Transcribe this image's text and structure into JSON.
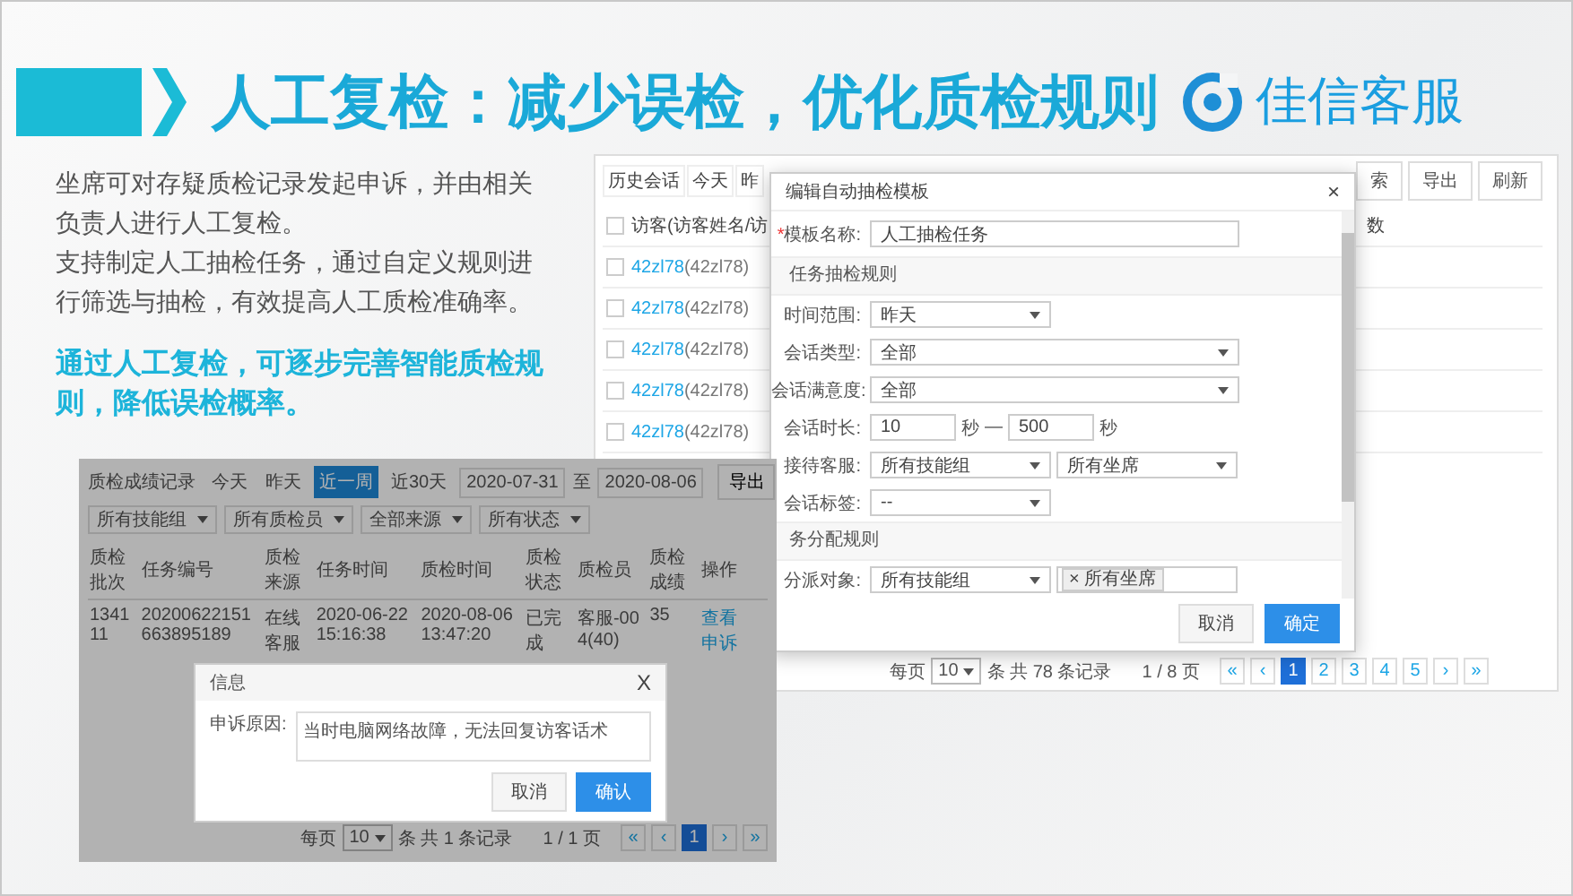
{
  "header": {
    "title": "人工复检：减少误检，优化质检规则",
    "brand": "佳信客服"
  },
  "intro": {
    "paragraphs": [
      "坐席可对存疑质检记录发起申诉，并由相关负责人进行人工复检。",
      "支持制定人工抽检任务，通过自定义规则进行筛选与抽检，有效提高人工质检准确率。"
    ],
    "highlight": "通过人工复检，可逐步完善智能质检规则，降低误检概率。"
  },
  "session_window": {
    "tabs": [
      {
        "label": "历史会话",
        "selected": false
      },
      {
        "label": "今天",
        "selected": false
      },
      {
        "label": "昨",
        "selected": false
      }
    ],
    "buttons": [
      "索",
      "导出",
      "刷新"
    ],
    "all_checked": false,
    "columns": [
      "访客(访客姓名/访",
      "数"
    ],
    "rows": [
      {
        "checked": false,
        "link": "42zl78",
        "name": "(42zl78)"
      },
      {
        "checked": false,
        "link": "42zl78",
        "name": "(42zl78)"
      },
      {
        "checked": false,
        "link": "42zl78",
        "name": "(42zl78)"
      },
      {
        "checked": false,
        "link": "42zl78",
        "name": "(42zl78)"
      },
      {
        "checked": false,
        "link": "42zl78",
        "name": "(42zl78)"
      }
    ],
    "pagination": {
      "per_page_label": "每页",
      "per_page": "10",
      "summary": "条 共 78 条记录",
      "pages_label": "1 / 8 页",
      "first": "«",
      "prev": "‹",
      "next": "›",
      "last": "»",
      "pages": [
        {
          "label": "1",
          "selected": true
        },
        {
          "label": "2",
          "selected": false
        },
        {
          "label": "3",
          "selected": false
        },
        {
          "label": "4",
          "selected": false
        },
        {
          "label": "5",
          "selected": false
        }
      ]
    }
  },
  "template_dialog": {
    "title": "编辑自动抽检模板",
    "close": "×",
    "name_field": {
      "label": "模板名称:",
      "required_mark": "*",
      "value": "人工抽检任务"
    },
    "sections": [
      {
        "title": "任务抽检规则",
        "rows": [
          {
            "kind": "short",
            "label": "时间范围:",
            "value": "昨天"
          },
          {
            "kind": "select",
            "label": "会话类型:",
            "value": "全部"
          },
          {
            "kind": "select",
            "label": "会话满意度:",
            "value": "全部"
          },
          {
            "kind": "range",
            "label": "会话时长:",
            "from": "10",
            "from_unit": "秒",
            "dash": "—",
            "to": "500",
            "to_unit": "秒"
          },
          {
            "kind": "pair",
            "label": "接待客服:",
            "value": "所有技能组",
            "second": "所有坐席"
          },
          {
            "kind": "short",
            "label": "会话标签:",
            "value": "--"
          }
        ]
      },
      {
        "title": "务分配规则",
        "rows": [
          {
            "kind": "tags",
            "label": "分派对象:",
            "value": "所有技能组",
            "tags": [
              {
                "remove": "×",
                "label": "所有坐席"
              }
            ]
          }
        ]
      }
    ],
    "buttons": [
      {
        "label": "取消",
        "primary": false
      },
      {
        "label": "确定",
        "primary": true
      }
    ]
  },
  "record_window": {
    "title": "质检成绩记录",
    "tabs": [
      {
        "label": "今天",
        "selected": false
      },
      {
        "label": "昨天",
        "selected": false
      },
      {
        "label": "近一周",
        "selected": true
      },
      {
        "label": "近30天",
        "selected": false
      }
    ],
    "date_from": "2020-07-31",
    "date_sep": "至",
    "date_to": "2020-08-06",
    "export": "导出",
    "filters": [
      "所有技能组",
      "所有质检员",
      "全部来源",
      "所有状态"
    ],
    "columns": [
      "质检批次",
      "任务编号",
      "质检来源",
      "任务时间",
      "质检时间",
      "质检状态",
      "质检员",
      "质检成绩",
      "操作"
    ],
    "rows": [
      {
        "cells": [
          "134111",
          "20200622151663895189",
          "在线客服",
          "2020-06-22 15:16:38",
          "2020-08-06 13:47:20",
          "已完成",
          "客服-004(40)",
          "35"
        ],
        "actions": [
          "查看",
          "申诉"
        ]
      }
    ],
    "appeal_dialog": {
      "title": "信息",
      "close": "X",
      "label": "申诉原因:",
      "value": "当时电脑网络故障，无法回复访客话术",
      "buttons": [
        {
          "label": "取消",
          "primary": false
        },
        {
          "label": "确认",
          "primary": true
        }
      ]
    },
    "pagination": {
      "per_page_label": "每页",
      "per_page": "10",
      "summary": "条 共 1 条记录",
      "pages_label": "1 / 1 页",
      "first": "«",
      "prev": "‹",
      "next": "›",
      "last": "»",
      "pages": [
        {
          "label": "1",
          "selected": true
        }
      ]
    }
  }
}
